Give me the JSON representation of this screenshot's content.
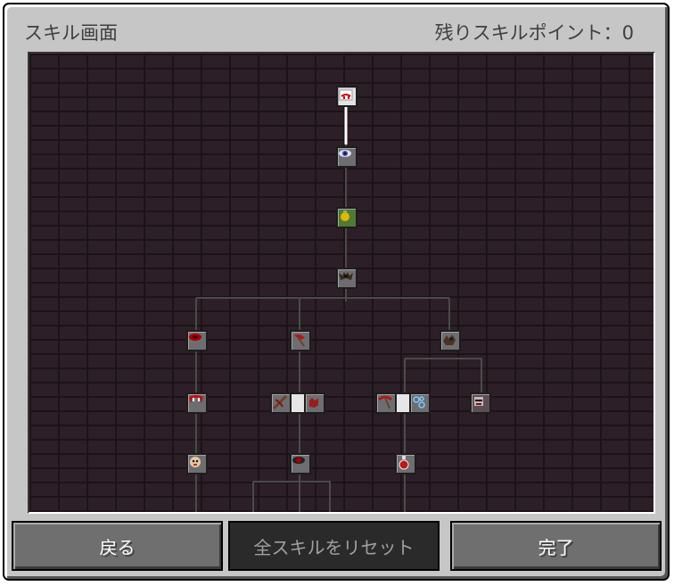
{
  "header": {
    "title": "スキル画面",
    "points": "残りスキルポイント：0"
  },
  "footer": {
    "back_label": "戻る",
    "reset_label": "全スキルをリセット",
    "done_label": "完了"
  },
  "skills": {
    "root": "vampire-face-icon",
    "tier1": "eye-icon",
    "tier2": "gold-potion-icon",
    "tier3": "bat-icon",
    "left_branch": [
      "blood-drop-icon",
      "fangs-icon",
      "skull-icon"
    ],
    "middle_branch": [
      "red-axe-icon",
      "crossbow-icon",
      "red-hand-icon",
      "red-eye-icon"
    ],
    "right_branch": [
      "bat-swarm-icon",
      "red-pick-icon",
      "blue-orbs-icon",
      "masked-face-icon",
      "potion-bottle-icon"
    ]
  },
  "colors": {
    "panel": "#c6c6c6",
    "tree_bg": "#2c1f27",
    "button": "#6f6f6f",
    "button_disabled": "#2a2a2a"
  }
}
